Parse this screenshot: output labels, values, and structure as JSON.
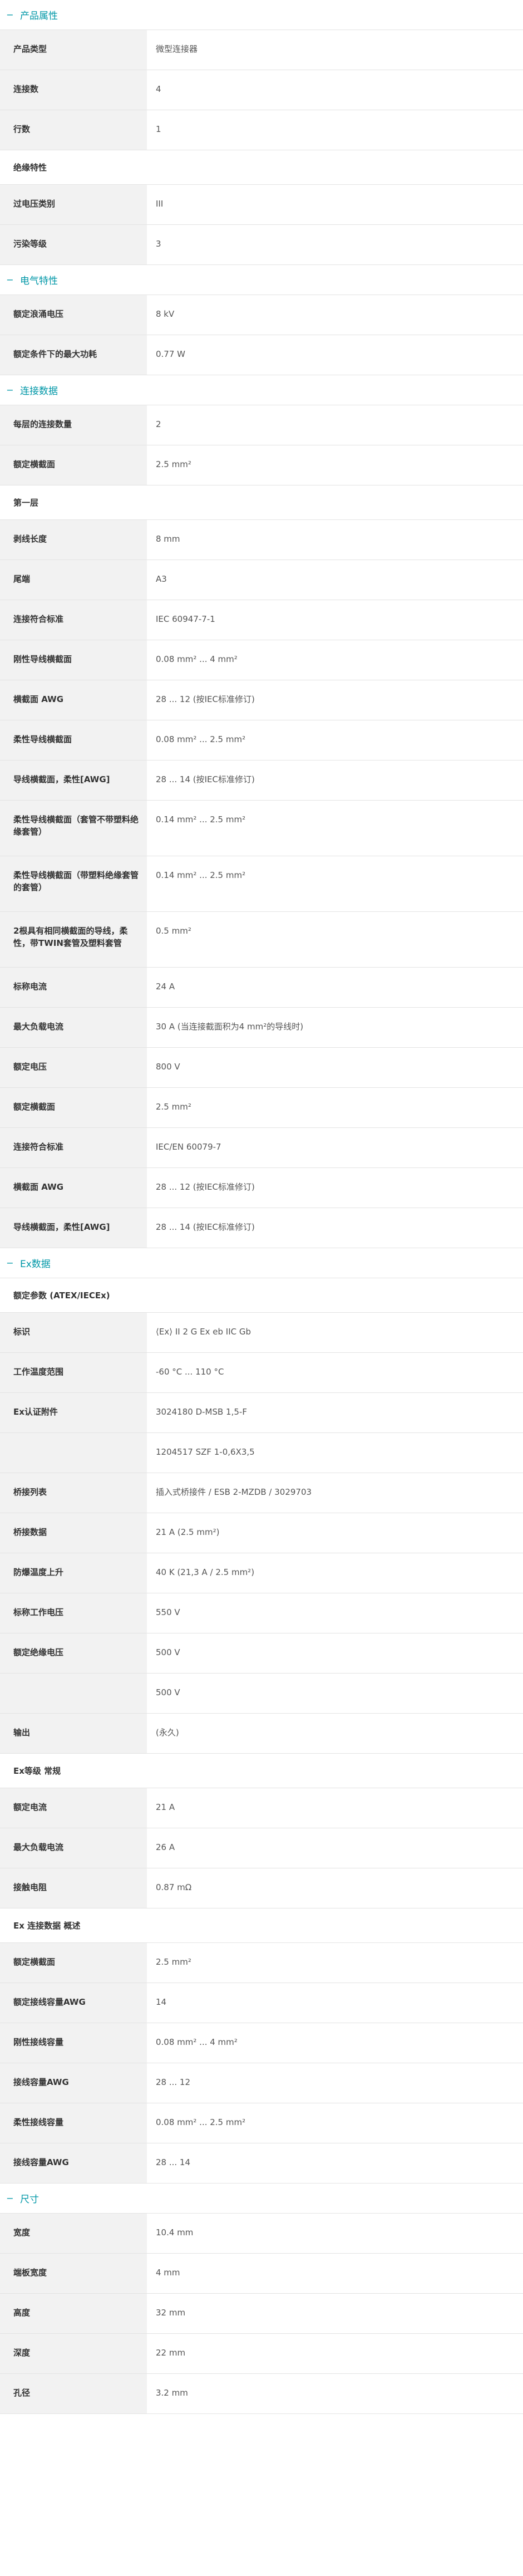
{
  "colors": {
    "accent": "#0097a7",
    "label_bg": "#f2f2f2",
    "divider": "#e3e3e3"
  },
  "icons": {
    "section_toggle": "minus-icon"
  },
  "sections": [
    {
      "title": "产品属性",
      "blocks": [
        {
          "rows": [
            {
              "label": "产品类型",
              "value": "微型连接器"
            },
            {
              "label": "连接数",
              "value": "4"
            },
            {
              "label": "行数",
              "value": "1"
            }
          ]
        },
        {
          "group": "绝缘特性",
          "rows": [
            {
              "label": "过电压类别",
              "value": "III"
            },
            {
              "label": "污染等级",
              "value": "3"
            }
          ]
        }
      ]
    },
    {
      "title": "电气特性",
      "blocks": [
        {
          "rows": [
            {
              "label": "额定浪涌电压",
              "value": "8 kV"
            },
            {
              "label": "额定条件下的最大功耗",
              "value": "0.77 W"
            }
          ]
        }
      ]
    },
    {
      "title": "连接数据",
      "blocks": [
        {
          "rows": [
            {
              "label": "每层的连接数量",
              "value": "2"
            },
            {
              "label": "额定横截面",
              "value": "2.5 mm²"
            }
          ]
        },
        {
          "group": "第一层",
          "rows": [
            {
              "label": "剥线长度",
              "value": "8 mm"
            },
            {
              "label": "尾端",
              "value": "A3"
            },
            {
              "label": "连接符合标准",
              "value": "IEC 60947-7-1"
            },
            {
              "label": "刚性导线横截面",
              "value": "0.08 mm² ... 4 mm²"
            },
            {
              "label": "横截面 AWG",
              "value": "28 ... 12 (按IEC标准修订)"
            },
            {
              "label": "柔性导线横截面",
              "value": "0.08 mm² ... 2.5 mm²"
            },
            {
              "label": "导线横截面，柔性[AWG]",
              "value": "28 ... 14 (按IEC标准修订)"
            },
            {
              "label": "柔性导线横截面（套管不带塑料绝缘套管）",
              "value": "0.14 mm² ... 2.5 mm²"
            },
            {
              "label": "柔性导线横截面（带塑料绝缘套管的套管）",
              "value": "0.14 mm² ... 2.5 mm²"
            },
            {
              "label": "2根具有相同横截面的导线，柔性，带TWIN套管及塑料套管",
              "value": "0.5 mm²"
            },
            {
              "label": "标称电流",
              "value": "24 A"
            },
            {
              "label": "最大负载电流",
              "value": "30 A (当连接截面积为4 mm²的导线时)"
            },
            {
              "label": "额定电压",
              "value": "800 V"
            },
            {
              "label": "额定横截面",
              "value": "2.5 mm²"
            },
            {
              "label": "连接符合标准",
              "value": "IEC/EN 60079-7"
            },
            {
              "label": "横截面 AWG",
              "value": "28 ... 12 (按IEC标准修订)"
            },
            {
              "label": "导线横截面，柔性[AWG]",
              "value": "28 ... 14 (按IEC标准修订)"
            }
          ]
        }
      ]
    },
    {
      "title": "Ex数据",
      "blocks": [
        {
          "group": "额定参数 (ATEX/IECEx)",
          "rows": [
            {
              "label": "标识",
              "value": "⟨Ex⟩ II 2 G  Ex eb IIC Gb"
            },
            {
              "label": "工作温度范围",
              "value": "-60 °C ... 110 °C"
            },
            {
              "label": "Ex认证附件",
              "value": "3024180 D-MSB 1,5-F"
            },
            {
              "label": "",
              "value": "1204517 SZF 1-0,6X3,5"
            },
            {
              "label": "桥接列表",
              "value": "插入式桥接件 / ESB 2-MZDB / 3029703"
            },
            {
              "label": "桥接数据",
              "value": "21 A (2.5 mm²)"
            },
            {
              "label": "防爆温度上升",
              "value": "40 K (21,3 A / 2.5 mm²)"
            },
            {
              "label": "标称工作电压",
              "value": "550 V"
            },
            {
              "label": "额定绝缘电压",
              "value": "500 V"
            },
            {
              "label": "",
              "value": "500 V"
            },
            {
              "label": "输出",
              "value": "(永久)"
            }
          ]
        },
        {
          "group": "Ex等级 常规",
          "rows": [
            {
              "label": "额定电流",
              "value": "21 A"
            },
            {
              "label": "最大负载电流",
              "value": "26 A"
            },
            {
              "label": "接触电阻",
              "value": "0.87 mΩ"
            }
          ]
        },
        {
          "group": "Ex 连接数据 概述",
          "rows": [
            {
              "label": "额定横截面",
              "value": "2.5 mm²"
            },
            {
              "label": "额定接线容量AWG",
              "value": "14"
            },
            {
              "label": "刚性接线容量",
              "value": "0.08 mm² ... 4 mm²"
            },
            {
              "label": "接线容量AWG",
              "value": "28 ... 12"
            },
            {
              "label": "柔性接线容量",
              "value": "0.08 mm² ... 2.5 mm²"
            },
            {
              "label": "接线容量AWG",
              "value": "28 ... 14"
            }
          ]
        }
      ]
    },
    {
      "title": "尺寸",
      "blocks": [
        {
          "rows": [
            {
              "label": "宽度",
              "value": "10.4 mm"
            },
            {
              "label": "端板宽度",
              "value": "4 mm"
            },
            {
              "label": "高度",
              "value": "32 mm"
            },
            {
              "label": "深度",
              "value": "22 mm"
            },
            {
              "label": "孔径",
              "value": "3.2 mm"
            }
          ]
        }
      ]
    }
  ]
}
